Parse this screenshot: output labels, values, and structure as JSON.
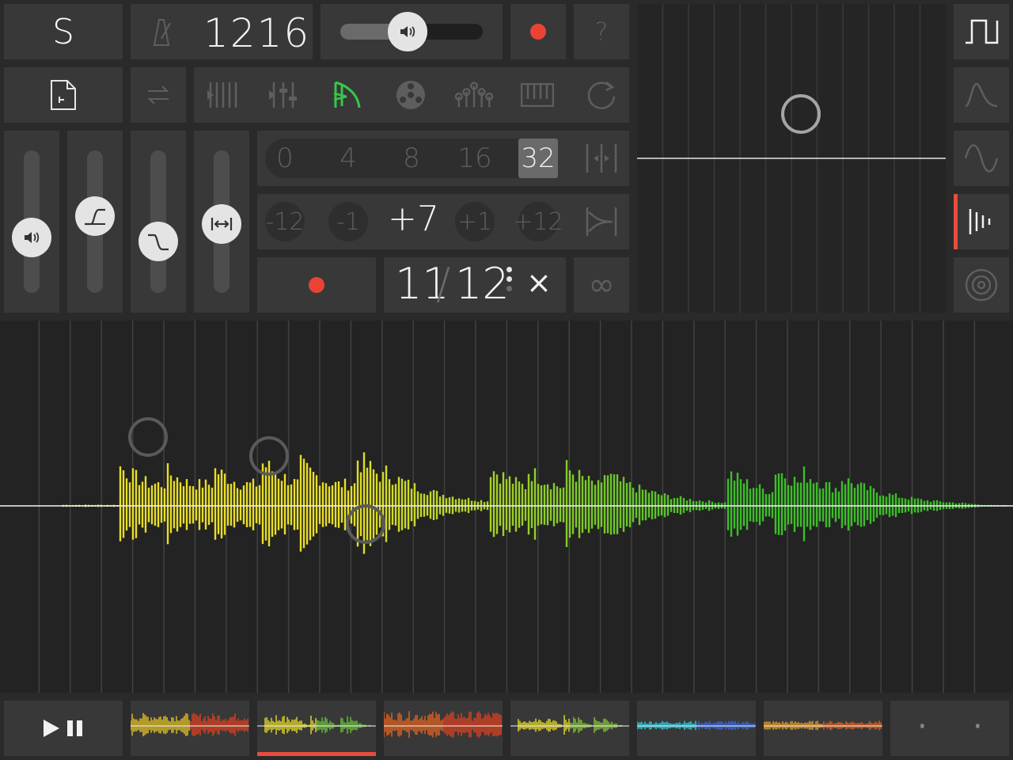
{
  "header": {
    "logo_letter": "S",
    "tempo_value": "1216",
    "help_label": "?"
  },
  "toolbar": {
    "icons": [
      "file-icon",
      "swap-icon",
      "sequencer-icon",
      "mixer-icon",
      "sample-icon",
      "tape-reel-icon",
      "sliders-icon",
      "keyboard-icon",
      "loop-icon"
    ],
    "active_icon": "sample-icon"
  },
  "steps": {
    "options": [
      "0",
      "4",
      "8",
      "16",
      "32"
    ],
    "selected": "32"
  },
  "pitch": {
    "options": [
      "-12",
      "-1",
      "+7",
      "+1",
      "+12"
    ],
    "selected": "+7"
  },
  "slice": {
    "numerator": "11",
    "separator": "/",
    "denominator": "12",
    "clear_label": "×",
    "infinity_label": "∞"
  },
  "sliders": {
    "volume_level": 0.36,
    "attack_level": 0.55,
    "release_level": 0.32,
    "stretch_level": 0.48
  },
  "master_volume_level": 0.47,
  "right_panel": {
    "waveforms": [
      "square-wave-icon",
      "decay-curve-icon",
      "sine-wave-icon",
      "sample-bars-icon",
      "target-icon"
    ],
    "active": "sample-bars-icon"
  },
  "colors": {
    "record_red": "#ea4335",
    "active_green": "#39c54c",
    "accent_red": "#ea4c3c",
    "wave_yellow": "#e8df25",
    "wave_green": "#6ac53a"
  },
  "bottom_bar": {
    "play_pause_icon": "play-pause-icon",
    "selected_track": 1,
    "dots": [
      "·",
      "·"
    ]
  }
}
